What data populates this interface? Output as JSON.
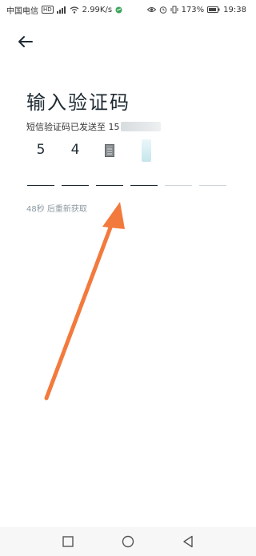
{
  "status_bar": {
    "carrier": "中国电信",
    "hd_badge": "HD",
    "speed": "2.99K/s",
    "battery_percent": "173%",
    "time": "19:38"
  },
  "page": {
    "title": "输入验证码",
    "sms_hint": "短信验证码已发送至 15",
    "resend": "48秒 后重新获取"
  },
  "code": {
    "digits": [
      "5",
      "4",
      "",
      "",
      "",
      ""
    ]
  },
  "icons": {
    "back": "arrow-left-icon",
    "recent": "square-icon",
    "home": "circle-icon",
    "back_nav": "triangle-left-icon"
  },
  "colors": {
    "annotation_arrow": "#f27a3d",
    "text_dark": "#1e2a32",
    "muted": "#8d9aa2"
  }
}
